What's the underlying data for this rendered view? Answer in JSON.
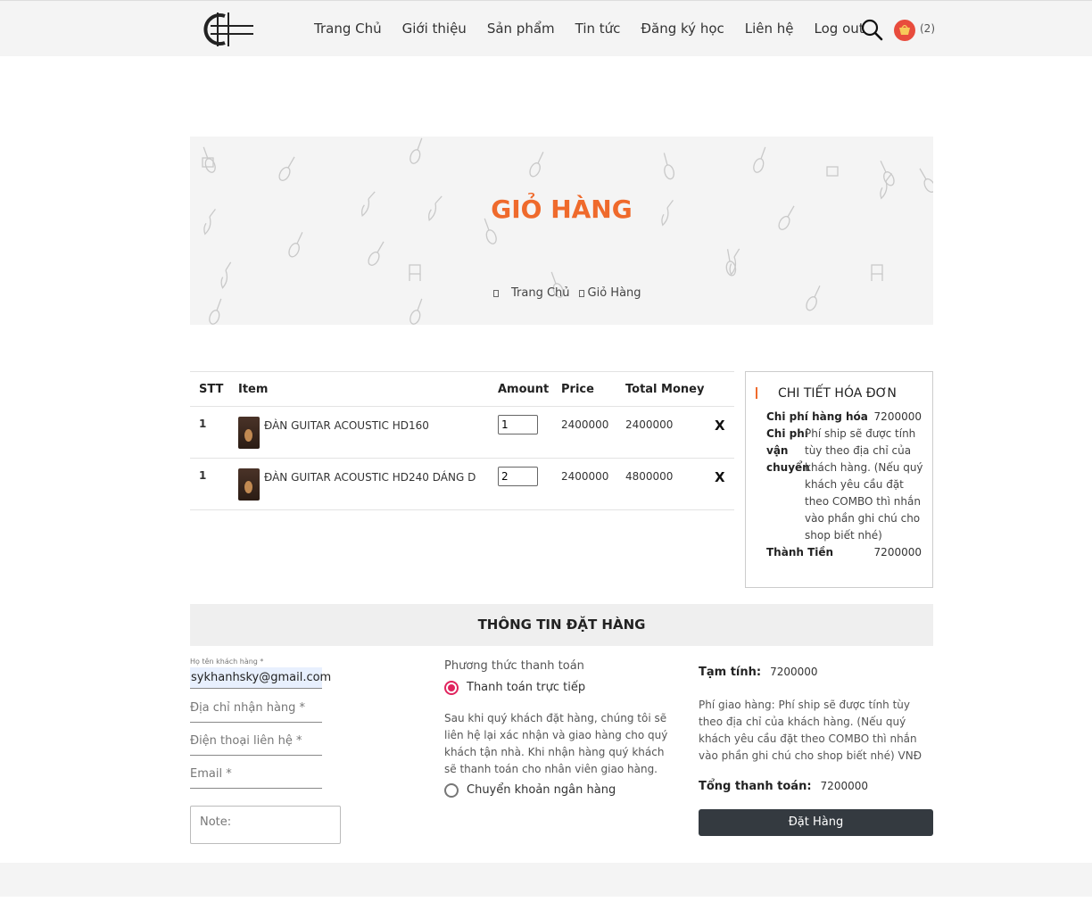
{
  "header": {
    "nav": [
      "Trang Chủ",
      "Giới thiệu",
      "Sản phẩm",
      "Tin tức",
      "Đăng ký học",
      "Liên hệ",
      "Log out"
    ],
    "cart_count": "(2)"
  },
  "banner": {
    "title": "GIỎ HÀNG",
    "breadcrumb_home": "Trang Chủ",
    "breadcrumb_current": "Giỏ Hàng"
  },
  "cart": {
    "headers": {
      "stt": "STT",
      "item": "Item",
      "amount": "Amount",
      "price": "Price",
      "total": "Total Money"
    },
    "rows": [
      {
        "stt": "1",
        "name": "ĐÀN GUITAR ACOUSTIC HD160",
        "qty": "1",
        "price": "2400000",
        "total": "2400000",
        "remove": "X"
      },
      {
        "stt": "1",
        "name": "ĐÀN GUITAR ACOUSTIC HD240 DÁNG D",
        "qty": "2",
        "price": "2400000",
        "total": "4800000",
        "remove": "X"
      }
    ]
  },
  "invoice": {
    "title": "CHI TIẾT HÓA ĐƠN",
    "goods_label": "Chi phí hàng hóa",
    "goods_value": "7200000",
    "ship_label_1": "Chi phí",
    "ship_label_2": "vận",
    "ship_label_3": "chuyển",
    "ship_value": "Phí ship sẽ được tính tùy theo địa chỉ của khách hàng. (Nếu quý khách yêu cầu đặt theo COMBO thì nhắn vào phần ghi chú cho shop biết nhé)",
    "total_label": "Thành Tiền",
    "total_value": "7200000"
  },
  "order": {
    "title": "THÔNG TIN ĐẶT HÀNG",
    "name_label": "Họ tên khách hàng *",
    "name_value": "sykhanhsky@gmail.com",
    "address_placeholder": "Địa chỉ nhận hàng *",
    "phone_placeholder": "Điện thoại liên hệ *",
    "email_placeholder": "Email *",
    "note_placeholder": "Note:",
    "payment_title": "Phương thức thanh toán",
    "payment_option_1": "Thanh toán trực tiếp",
    "payment_desc": "Sau khi quý khách đặt hàng, chúng tôi sẽ liên hệ lại xác nhận và giao hàng cho quý khách tận nhà. Khi nhận hàng quý khách sẽ thanh toán cho nhân viên giao hàng.",
    "payment_option_2": "Chuyển khoản ngân hàng",
    "subtotal_label": "Tạm tính:",
    "subtotal_value": "7200000",
    "shipping_note": "Phí giao hàng: Phí ship sẽ được tính tùy theo địa chỉ của khách hàng. (Nếu quý khách yêu cầu đặt theo COMBO thì nhắn vào phần ghi chú cho shop biết nhé) VNĐ",
    "grand_total_label": "Tổng thanh toán:",
    "grand_total_value": "7200000",
    "submit_label": "Đặt Hàng"
  },
  "colors": {
    "accent": "#ef6a2c",
    "radio": "#e0245e",
    "button": "#343a40"
  }
}
